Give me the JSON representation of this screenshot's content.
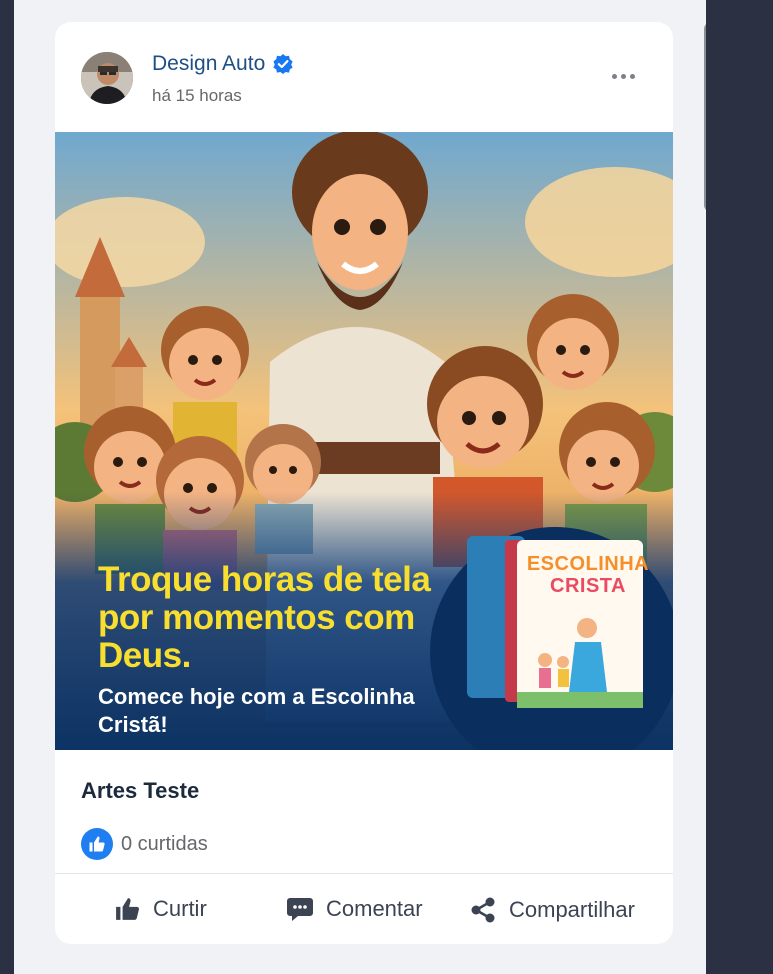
{
  "post": {
    "author": "Design Auto",
    "time": "há 15 horas",
    "verified_icon": "verified-badge-icon",
    "more_icon": "more-horizontal-icon"
  },
  "image": {
    "headline": "Troque horas de tela por momentos com Deus.",
    "subline": "Comece hoje com a Escolinha Cristã!",
    "book_title_line1": "ESCOLINHA",
    "book_title_line2": "CRISTA"
  },
  "caption": "Artes Teste",
  "reactions": {
    "likes_text": "0 curtidas",
    "like_icon": "thumbs-up-icon"
  },
  "actions": [
    {
      "label": "Curtir",
      "icon": "thumbs-up-icon"
    },
    {
      "label": "Comentar",
      "icon": "comment-icon"
    },
    {
      "label": "Compartilhar",
      "icon": "share-icon"
    }
  ],
  "colors": {
    "author": "#1d4f86",
    "verified": "#1877f2",
    "headline": "#f7de2f",
    "image_bottom": "#0f3d7a",
    "like_badge": "#1f7ef0"
  }
}
